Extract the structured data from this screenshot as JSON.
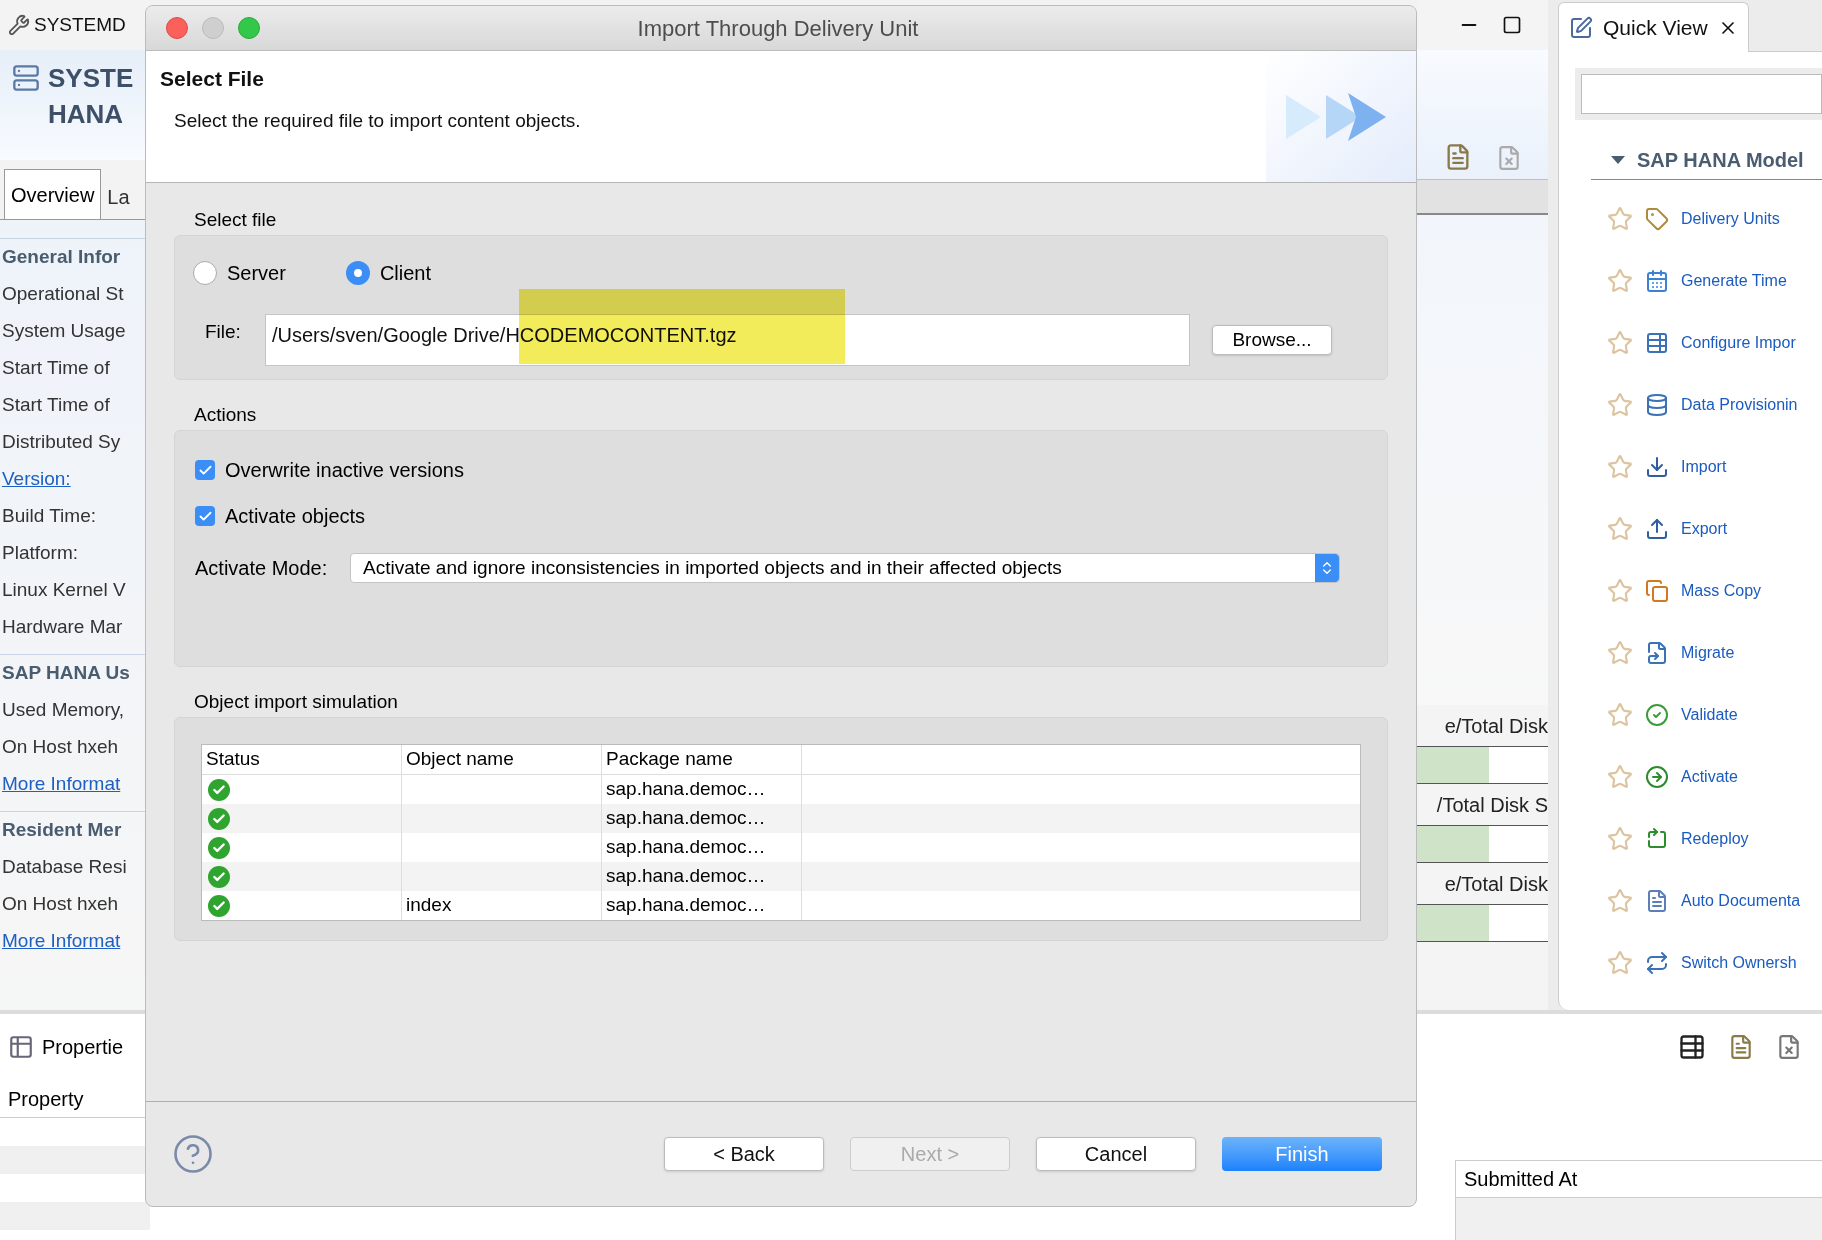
{
  "background": {
    "window_title": "SYSTEMD",
    "editor_title": [
      "SYSTE",
      "HANA"
    ],
    "tabs": [
      {
        "label": "Overview",
        "selected": true
      },
      {
        "label": "La",
        "selected": false
      }
    ],
    "sections": [
      {
        "kind": "heading",
        "text": "General Infor"
      },
      {
        "kind": "label",
        "text": "Operational St"
      },
      {
        "kind": "label",
        "text": "System Usage"
      },
      {
        "kind": "label",
        "text": "Start Time of"
      },
      {
        "kind": "label",
        "text": "Start Time of"
      },
      {
        "kind": "label",
        "text": "Distributed Sy"
      },
      {
        "kind": "link",
        "text": "Version:"
      },
      {
        "kind": "label",
        "text": "Build Time:"
      },
      {
        "kind": "label",
        "text": "Platform:"
      },
      {
        "kind": "label",
        "text": "Linux Kernel V"
      },
      {
        "kind": "label",
        "text": "Hardware Mar"
      },
      {
        "kind": "heading",
        "text": "SAP HANA Us"
      },
      {
        "kind": "label",
        "text": "Used Memory,"
      },
      {
        "kind": "label",
        "text": "On Host hxeh"
      },
      {
        "kind": "link",
        "text": "More Informat"
      },
      {
        "kind": "heading",
        "text": "Resident Mer"
      },
      {
        "kind": "label",
        "text": "Database Resi"
      },
      {
        "kind": "label",
        "text": "On Host hxeh"
      },
      {
        "kind": "link",
        "text": "More Informat"
      }
    ],
    "disk_rows": [
      {
        "label": "e/Total Disk",
        "level": 0.55
      },
      {
        "label": "/Total Disk S",
        "level": 0.55
      },
      {
        "label": "e/Total Disk",
        "level": 0.55
      }
    ],
    "properties": {
      "tab": "Propertie",
      "column": "Property"
    },
    "jobs": {
      "column": "Submitted At"
    }
  },
  "quick_view": {
    "title": "Quick View",
    "group": "SAP HANA Model",
    "expanded": true,
    "items": [
      {
        "label": "Delivery Units",
        "starred": false
      },
      {
        "label": "Generate Time",
        "starred": false
      },
      {
        "label": "Configure Impor",
        "starred": false
      },
      {
        "label": "Data Provisionin",
        "starred": false
      },
      {
        "label": "Import",
        "starred": false
      },
      {
        "label": "Export",
        "starred": false
      },
      {
        "label": "Mass Copy",
        "starred": false
      },
      {
        "label": "Migrate",
        "starred": false
      },
      {
        "label": "Validate",
        "starred": false
      },
      {
        "label": "Activate",
        "starred": false
      },
      {
        "label": "Redeploy",
        "starred": false
      },
      {
        "label": "Auto Documenta",
        "starred": false
      },
      {
        "label": "Switch Ownersh",
        "starred": false
      }
    ]
  },
  "dialog": {
    "title": "Import Through Delivery Unit",
    "page_title": "Select File",
    "description": "Select the required file to import content objects.",
    "file_section": {
      "label": "Select file",
      "options": [
        {
          "label": "Server",
          "selected": false
        },
        {
          "label": "Client",
          "selected": true
        }
      ],
      "file_label": "File:",
      "file_value": "/Users/sven/Google Drive/HCODEMOCONTENT.tgz",
      "browse": "Browse..."
    },
    "actions": {
      "label": "Actions",
      "options": [
        {
          "label": "Overwrite inactive versions",
          "checked": true
        },
        {
          "label": "Activate objects",
          "checked": true
        }
      ],
      "mode_label": "Activate Mode:",
      "mode_value": "Activate and ignore inconsistencies in imported objects and in their affected objects"
    },
    "simulation": {
      "label": "Object import simulation",
      "columns": [
        "Status",
        "Object name",
        "Package name"
      ],
      "rows": [
        {
          "passed": true,
          "package": "sap.hana.democ…"
        },
        {
          "passed": true,
          "package": "sap.hana.democ…"
        },
        {
          "passed": true,
          "package": "sap.hana.democ…"
        },
        {
          "passed": true,
          "package": "sap.hana.democ…"
        },
        {
          "passed": true,
          "object_name": "index",
          "package": "sap.hana.democ…"
        }
      ]
    },
    "buttons": [
      {
        "label": "< Back",
        "kind": "default",
        "disabled": false
      },
      {
        "label": "Next >",
        "kind": "default",
        "disabled": true
      },
      {
        "label": "Cancel",
        "kind": "default",
        "disabled": false
      },
      {
        "label": "Finish",
        "kind": "primary",
        "disabled": false
      }
    ]
  }
}
